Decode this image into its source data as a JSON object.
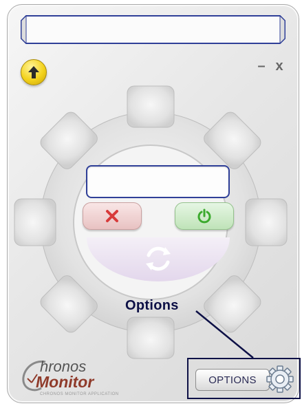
{
  "window": {
    "title_field": {
      "value": ""
    },
    "display_field": {
      "value": ""
    },
    "buttons": {
      "up_icon": "arrow-up-icon",
      "minimize": "–",
      "close": "x",
      "cancel_icon": "x-icon",
      "power_icon": "power-icon",
      "refresh_icon": "refresh-icon"
    },
    "options_label": "Options",
    "options_button_label": "OPTIONS",
    "logo": {
      "line1": "hronos",
      "line2": "Monitor",
      "tagline": "CHRONOS MONITOR APPLICATION"
    },
    "colors": {
      "accent_navy": "#0d1046",
      "cancel_red": "#d83a3a",
      "power_green": "#3caa2e",
      "logo_red": "#8f3b2b"
    }
  }
}
